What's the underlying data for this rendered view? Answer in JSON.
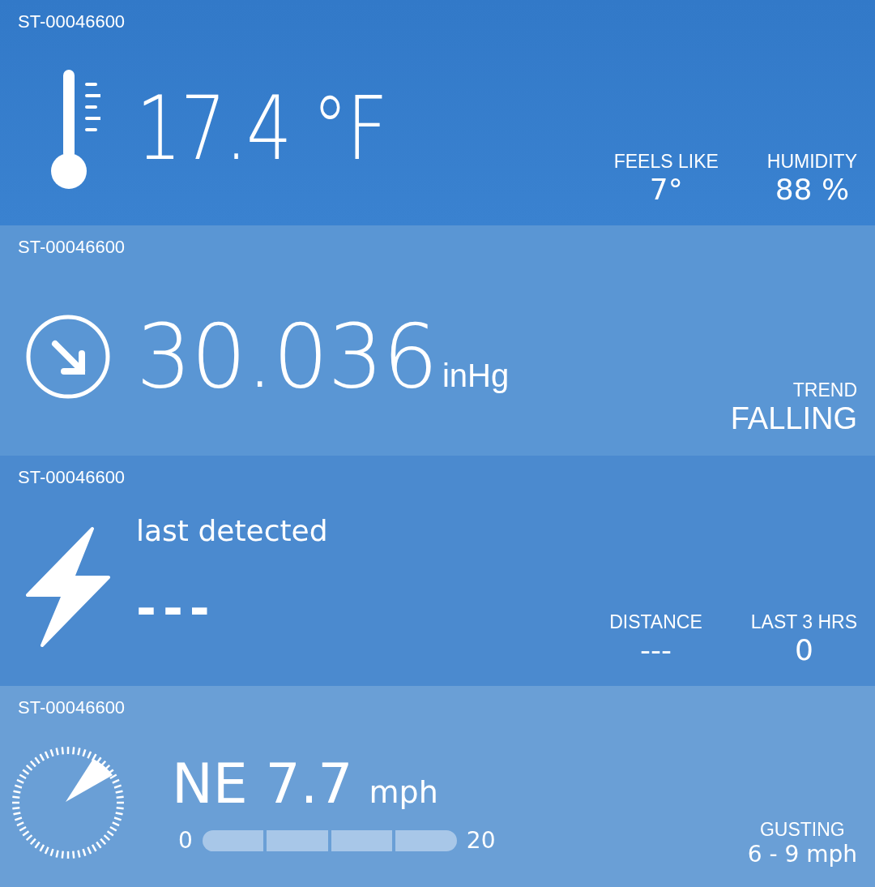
{
  "panels": [
    {
      "kind": "temperature",
      "station": "ST-00046600",
      "value": "17.4 °F",
      "stats": [
        {
          "label": "FEELS LIKE",
          "value": "7°"
        },
        {
          "label": "HUMIDITY",
          "value": "88 %"
        }
      ]
    },
    {
      "kind": "pressure",
      "station": "ST-00046600",
      "value": "30.036",
      "unit": "inHg",
      "stats": [
        {
          "label": "TREND",
          "value": "FALLING"
        }
      ]
    },
    {
      "kind": "lightning",
      "station": "ST-00046600",
      "caption": "last detected",
      "value": "---",
      "stats": [
        {
          "label": "DISTANCE",
          "value": "---"
        },
        {
          "label": "LAST 3 HRS",
          "value": "0"
        }
      ]
    },
    {
      "kind": "wind",
      "station": "ST-00046600",
      "value": "NE 7.7",
      "unit": "mph",
      "scale_min": "0",
      "scale_max": "20",
      "stats": [
        {
          "label": "GUSTING",
          "value": "6 - 9 mph"
        }
      ]
    }
  ]
}
